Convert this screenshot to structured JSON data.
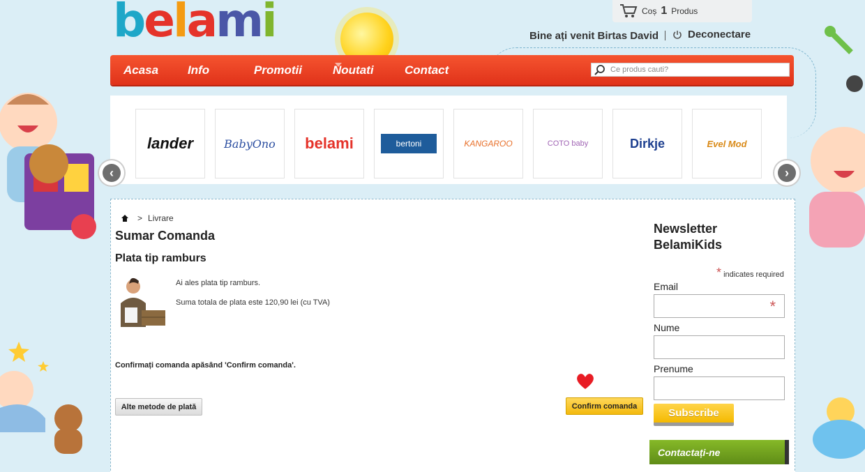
{
  "header": {
    "logo_letters": [
      "b",
      "e",
      "l",
      "a",
      "m",
      "i"
    ],
    "logo_colors": [
      "#1ea7c8",
      "#e5332a",
      "#f49b12",
      "#e5332a",
      "#4a57a7",
      "#80b52e"
    ],
    "cart_label": "Coș",
    "cart_count": "1",
    "cart_unit": "Produs",
    "welcome": "Bine ați venit Birtas David",
    "logout": "Deconectare"
  },
  "nav": {
    "items": [
      "Acasa",
      "Info",
      "Promotii",
      "Noutati",
      "Contact"
    ],
    "search_placeholder": "Ce produs cauti?"
  },
  "brands": [
    {
      "name": "lander",
      "color": "#111"
    },
    {
      "name": "BabyOno",
      "color": "#2a4da0"
    },
    {
      "name": "belami",
      "color": "#e5332a"
    },
    {
      "name": "bertoni",
      "color": "#1e5c9b"
    },
    {
      "name": "KANGAROO",
      "color": "#e8702a"
    },
    {
      "name": "COTO baby",
      "color": "#a064b4"
    },
    {
      "name": "Dirkje",
      "color": "#1d3f8f"
    },
    {
      "name": "Evel Mod",
      "color": "#d98a18"
    }
  ],
  "breadcrumb": {
    "home_icon": "home-icon",
    "separator": ">",
    "current": "Livrare"
  },
  "order": {
    "title": "Sumar Comanda",
    "subtitle": "Plata tip ramburs",
    "line1": "Ai ales plata tip ramburs.",
    "line2": "Suma totala de plata este 120,90 lei (cu TVA)",
    "confirm_note": "Confirmați comanda apăsând 'Confirm comanda'.",
    "alt_button": "Alte metode de plată",
    "confirm_button": "Confirm comanda"
  },
  "newsletter": {
    "title": "Newsletter BelamiKids",
    "required_note": "indicates required",
    "email_label": "Email",
    "name_label": "Nume",
    "firstname_label": "Prenume",
    "subscribe": "Subscribe",
    "contact": "Contactați-ne"
  },
  "colors": {
    "nav": "#e8401f",
    "accent_yellow": "#f4b900",
    "contact_green": "#6f9f1e"
  }
}
